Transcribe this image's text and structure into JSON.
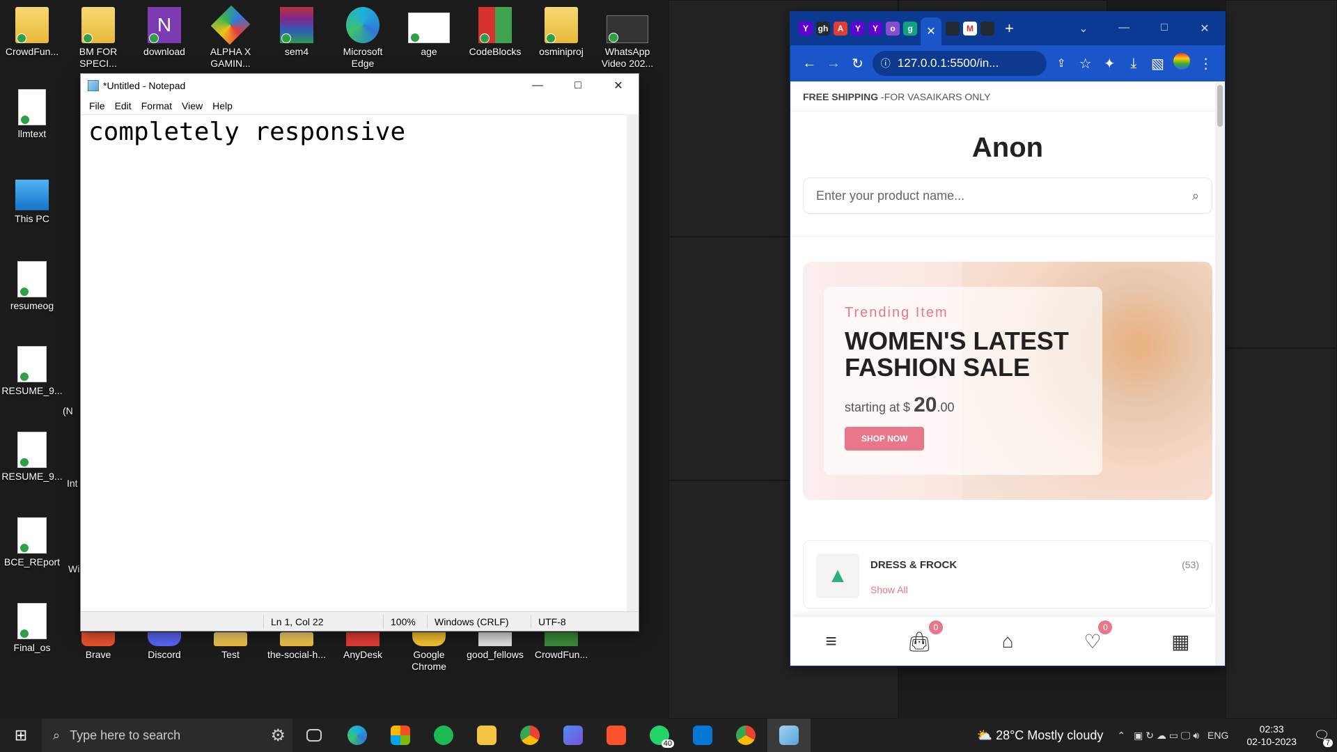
{
  "desktop": {
    "icons_top": [
      {
        "label": "CrowdFun..."
      },
      {
        "label": "BM FOR SPECI..."
      },
      {
        "label": "download"
      },
      {
        "label": "ALPHA X GAMIN..."
      },
      {
        "label": "sem4"
      },
      {
        "label": "Microsoft Edge"
      },
      {
        "label": "age"
      },
      {
        "label": "CodeBlocks"
      },
      {
        "label": "osminiproj"
      },
      {
        "label": "WhatsApp Video 202..."
      }
    ],
    "icons_left": [
      {
        "label": "llmtext"
      },
      {
        "label": "This PC"
      },
      {
        "label": "resumeog"
      },
      {
        "label": "RESUME_9..."
      },
      {
        "label": "RESUME_9..."
      },
      {
        "label": "BCE_REport"
      },
      {
        "label": "Final_os"
      }
    ],
    "icons_bottom": [
      {
        "label": "Brave"
      },
      {
        "label": "Discord"
      },
      {
        "label": "Test"
      },
      {
        "label": "the-social-h..."
      },
      {
        "label": "AnyDesk"
      },
      {
        "label": "Google Chrome"
      },
      {
        "label": "good_fellows"
      },
      {
        "label": "CrowdFun..."
      }
    ],
    "partial_labels": [
      "(N",
      "Int",
      "Wi"
    ]
  },
  "notepad": {
    "title": "*Untitled - Notepad",
    "menu": [
      "File",
      "Edit",
      "Format",
      "View",
      "Help"
    ],
    "content": "completely responsive",
    "status": {
      "position": "Ln 1, Col 22",
      "zoom": "100%",
      "eol": "Windows (CRLF)",
      "encoding": "UTF-8"
    }
  },
  "browser": {
    "url": "127.0.0.1:5500/in...",
    "tab_icons": [
      "Y",
      "gh",
      "A",
      "Y",
      "Y",
      "o",
      "g"
    ],
    "site": {
      "topbar_bold": "FREE SHIPPING",
      "topbar_rest": "-FOR VASAIKARS ONLY",
      "logo": "Anon",
      "search_placeholder": "Enter your product name...",
      "banner": {
        "subtitle": "Trending Item",
        "title_line1": "WOMEN'S LATEST",
        "title_line2": "FASHION SALE",
        "price_prefix": "starting at $",
        "price_main": "20",
        "price_cents": ".00",
        "button": "SHOP NOW"
      },
      "category": {
        "name": "DRESS & FROCK",
        "count": "(53)",
        "link": "Show All"
      },
      "nav_badges": {
        "cart": "0",
        "wishlist": "0"
      }
    }
  },
  "taskbar": {
    "search_placeholder": "Type here to search",
    "whatsapp_badge": "40",
    "weather": "28°C  Mostly cloudy",
    "language": "ENG",
    "time": "02:33",
    "date": "02-10-2023",
    "notifications": "7"
  }
}
